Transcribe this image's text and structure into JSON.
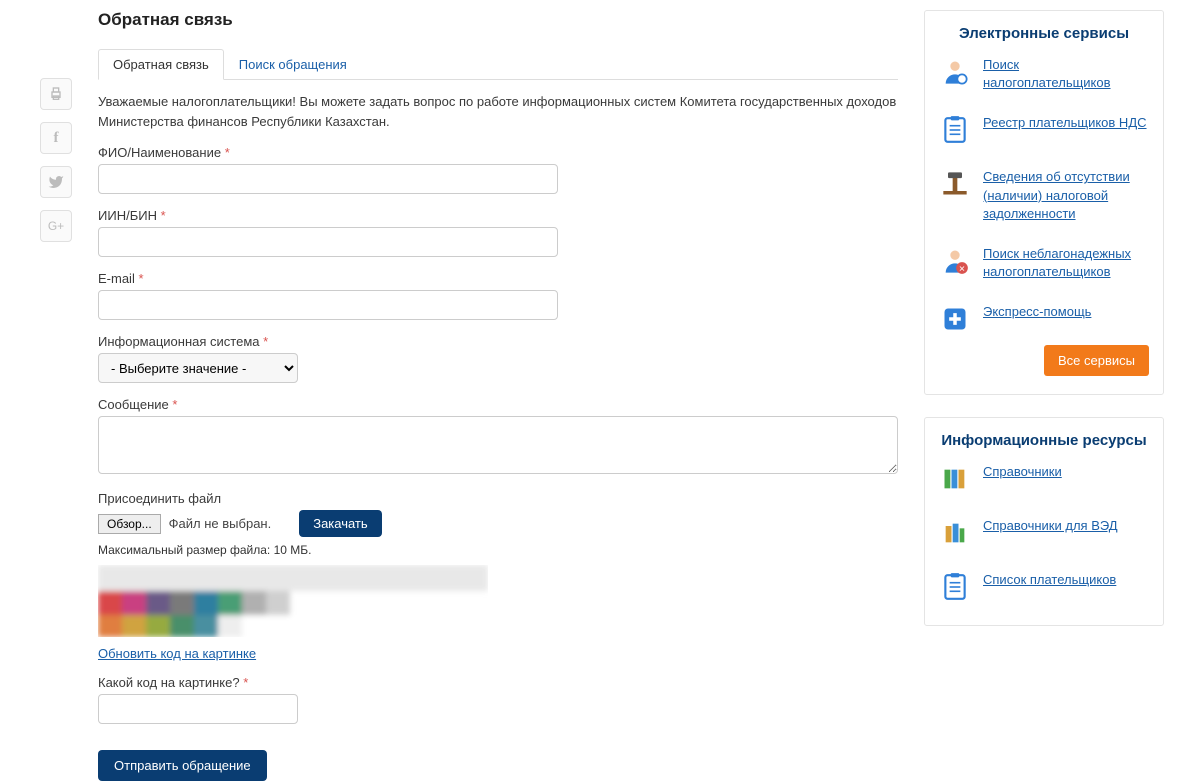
{
  "page_title": "Обратная связь",
  "tabs": {
    "active": "Обратная связь",
    "search": "Поиск обращения"
  },
  "intro": "Уважаемые налогоплательщики! Вы можете задать вопрос по работе информационных систем Комитета государственных доходов Министерства финансов Республики Казахстан.",
  "form": {
    "fio_label": "ФИО/Наименование",
    "iin_label": "ИИН/БИН",
    "email_label": "E-mail",
    "system_label": "Информационная система",
    "system_selected": "- Выберите значение -",
    "message_label": "Сообщение",
    "attach_label": "Присоединить файл",
    "browse_label": "Обзор...",
    "file_status": "Файл не выбран.",
    "upload_label": "Закачать",
    "file_hint": "Максимальный размер файла: 10 МБ.",
    "refresh_captcha": "Обновить код на картинке",
    "captcha_label": "Какой код на картинке?",
    "submit_label": "Отправить обращение"
  },
  "services": {
    "title": "Электронные сервисы",
    "items": [
      {
        "label": "Поиск налогоплательщиков",
        "icon": "user-search"
      },
      {
        "label": "Реестр плательщиков НДС",
        "icon": "clipboard"
      },
      {
        "label": "Сведения об отсутствии (наличии) налоговой задолженности",
        "icon": "hammer"
      },
      {
        "label": "Поиск неблагонадежных налогоплательщиков",
        "icon": "user-warn"
      },
      {
        "label": "Экспресс-помощь",
        "icon": "help"
      }
    ],
    "all_button": "Все сервисы"
  },
  "resources": {
    "title": "Информационные ресурсы",
    "items": [
      {
        "label": "Справочники",
        "icon": "books"
      },
      {
        "label": "Справочники для ВЭД",
        "icon": "books-alt"
      },
      {
        "label": "Список плательщиков",
        "icon": "clipboard"
      }
    ]
  }
}
